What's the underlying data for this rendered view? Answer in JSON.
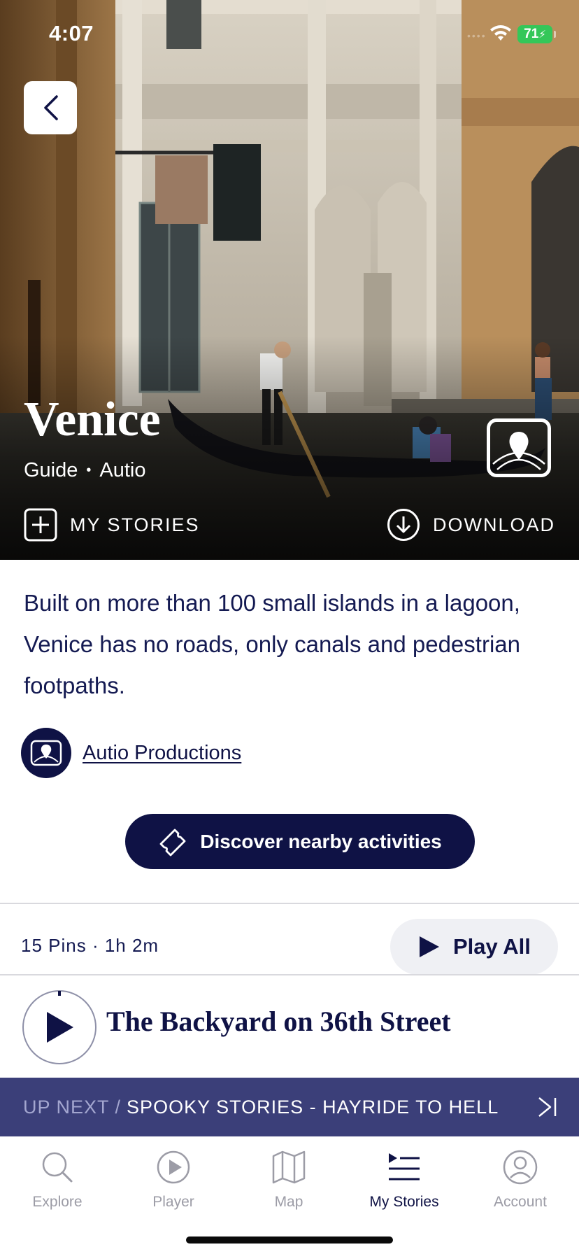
{
  "status_bar": {
    "time": "4:07",
    "battery": "71"
  },
  "hero": {
    "title": "Venice",
    "type": "Guide",
    "separator": "•",
    "publisher": "Autio",
    "my_stories_label": "MY STORIES",
    "download_label": "DOWNLOAD"
  },
  "content": {
    "description": "Built on more than 100 small islands in a lagoon, Venice has no roads, only canals and pedestrian footpaths.",
    "producer_name": "Autio Productions",
    "discover_label": "Discover nearby activities",
    "pins_info": "15 Pins · 1h 2m",
    "play_all_label": "Play All"
  },
  "player": {
    "now_playing": "The Backyard on 36th Street",
    "up_next_prefix": "UP NEXT /",
    "up_next_title": "SPOOKY STORIES - HAYRIDE TO HELL"
  },
  "tabs": [
    {
      "label": "Explore",
      "icon": "search-icon",
      "active": false
    },
    {
      "label": "Player",
      "icon": "play-circle-icon",
      "active": false
    },
    {
      "label": "Map",
      "icon": "map-icon",
      "active": false
    },
    {
      "label": "My Stories",
      "icon": "playlist-icon",
      "active": true
    },
    {
      "label": "Account",
      "icon": "account-icon",
      "active": false
    }
  ],
  "colors": {
    "brand_navy": "#0f1245",
    "up_next_bar": "#3b3f79",
    "battery_green": "#34c759"
  }
}
